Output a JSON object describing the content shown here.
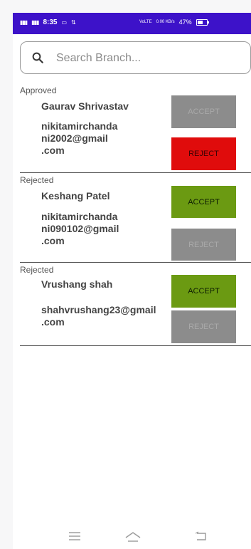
{
  "status_bar": {
    "network_left": "⁴ᴳ",
    "network_left2": "⁴ᴳ",
    "time": "8:35",
    "vo_lte": "VoLTE",
    "speed": "0.00 KB/s",
    "battery": "47%"
  },
  "search": {
    "placeholder": "Search Branch..."
  },
  "requests": [
    {
      "status": "Approved",
      "name": "Gaurav Shrivastav",
      "email_lines": [
        "nikitamirchanda",
        "ni2002@gmail",
        ".com"
      ],
      "accept_label": "ACCEPT",
      "reject_label": "REJECT"
    },
    {
      "status": "Rejected",
      "name": "Keshang Patel",
      "email_lines": [
        "nikitamirchanda",
        "ni090102@gmail",
        ".com"
      ],
      "accept_label": "ACCEPT",
      "reject_label": "REJECT"
    },
    {
      "status": "Rejected",
      "name": "Vrushang shah",
      "email_lines": [
        "shahvrushang23@gmail",
        ".com"
      ],
      "accept_label": "ACCEPT",
      "reject_label": "REJECT"
    }
  ],
  "colors": {
    "status_bar": "#3d12c9",
    "accept_active": "#6b9a12",
    "reject_active": "#e00c0c",
    "disabled": "#8c8c8c"
  },
  "nav_icons": [
    "menu-icon",
    "home-icon",
    "back-icon"
  ]
}
